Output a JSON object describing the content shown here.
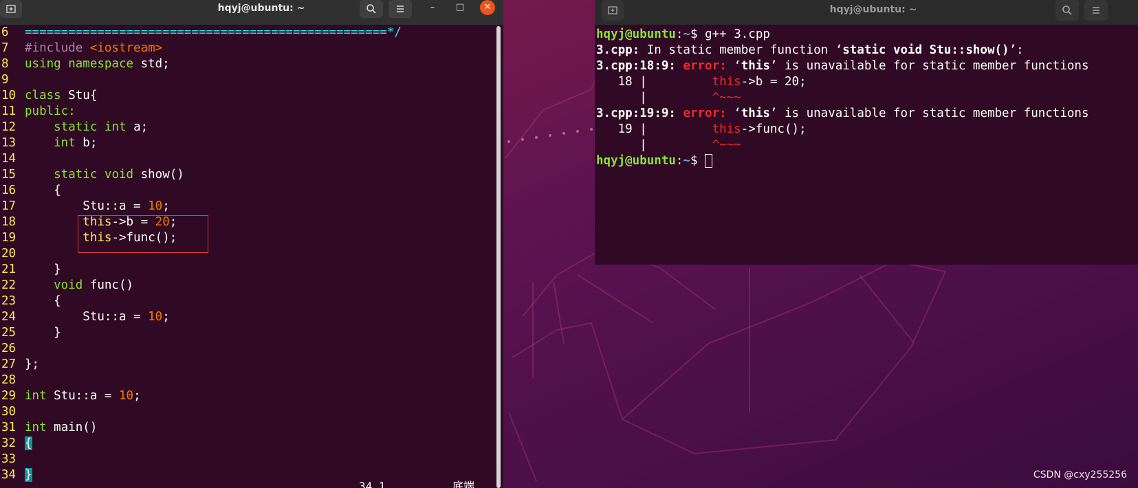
{
  "left_window": {
    "title": "hqyj@ubuntu: ~",
    "new_tab_icon": "new-tab-icon",
    "search_icon": "search-icon",
    "menu_icon": "hamburger-menu-icon",
    "minimize_glyph": "–",
    "maximize_glyph": "□",
    "close_glyph": "✕",
    "status_position": "34,1",
    "status_scroll": "底端"
  },
  "right_window": {
    "title": "hqyj@ubuntu: ~",
    "new_tab_icon": "new-tab-icon",
    "search_icon": "search-icon",
    "menu_icon": "hamburger-menu-icon"
  },
  "editor_lines": [
    {
      "n": "6",
      "parts": [
        {
          "t": "==================================================*/",
          "c": "c-cmt"
        }
      ]
    },
    {
      "n": "7",
      "parts": [
        {
          "t": "#include ",
          "c": "c-pp"
        },
        {
          "t": "<iostream>",
          "c": "c-num"
        }
      ]
    },
    {
      "n": "8",
      "parts": [
        {
          "t": "using ",
          "c": "c-kw"
        },
        {
          "t": "namespace ",
          "c": "c-kw"
        },
        {
          "t": "std;",
          "c": ""
        }
      ]
    },
    {
      "n": "9",
      "parts": []
    },
    {
      "n": "10",
      "parts": [
        {
          "t": "class ",
          "c": "c-kw"
        },
        {
          "t": "Stu{",
          "c": ""
        }
      ]
    },
    {
      "n": "11",
      "parts": [
        {
          "t": "public:",
          "c": "c-kw"
        }
      ]
    },
    {
      "n": "12",
      "parts": [
        {
          "t": "    static ",
          "c": "c-kw"
        },
        {
          "t": "int ",
          "c": "c-kw"
        },
        {
          "t": "a;",
          "c": ""
        }
      ]
    },
    {
      "n": "13",
      "parts": [
        {
          "t": "    int ",
          "c": "c-kw"
        },
        {
          "t": "b;",
          "c": ""
        }
      ]
    },
    {
      "n": "14",
      "parts": []
    },
    {
      "n": "15",
      "parts": [
        {
          "t": "    static ",
          "c": "c-kw"
        },
        {
          "t": "void ",
          "c": "c-kw"
        },
        {
          "t": "show()",
          "c": ""
        }
      ]
    },
    {
      "n": "16",
      "parts": [
        {
          "t": "    {",
          "c": ""
        }
      ]
    },
    {
      "n": "17",
      "parts": [
        {
          "t": "        Stu::a = ",
          "c": ""
        },
        {
          "t": "10",
          "c": "c-num"
        },
        {
          "t": ";",
          "c": ""
        }
      ]
    },
    {
      "n": "18",
      "parts": [
        {
          "t": "        ",
          "c": ""
        },
        {
          "t": "this",
          "c": "c-this"
        },
        {
          "t": "->b = ",
          "c": ""
        },
        {
          "t": "20",
          "c": "c-num"
        },
        {
          "t": ";",
          "c": ""
        }
      ]
    },
    {
      "n": "19",
      "parts": [
        {
          "t": "        ",
          "c": ""
        },
        {
          "t": "this",
          "c": "c-this"
        },
        {
          "t": "->func();",
          "c": ""
        }
      ]
    },
    {
      "n": "20",
      "parts": []
    },
    {
      "n": "21",
      "parts": [
        {
          "t": "    }",
          "c": ""
        }
      ]
    },
    {
      "n": "22",
      "parts": [
        {
          "t": "    void ",
          "c": "c-kw"
        },
        {
          "t": "func()",
          "c": ""
        }
      ]
    },
    {
      "n": "23",
      "parts": [
        {
          "t": "    {",
          "c": ""
        }
      ]
    },
    {
      "n": "24",
      "parts": [
        {
          "t": "        Stu::a = ",
          "c": ""
        },
        {
          "t": "10",
          "c": "c-num"
        },
        {
          "t": ";",
          "c": ""
        }
      ]
    },
    {
      "n": "25",
      "parts": [
        {
          "t": "    }",
          "c": ""
        }
      ]
    },
    {
      "n": "26",
      "parts": []
    },
    {
      "n": "27",
      "parts": [
        {
          "t": "};",
          "c": ""
        }
      ]
    },
    {
      "n": "28",
      "parts": []
    },
    {
      "n": "29",
      "parts": [
        {
          "t": "int ",
          "c": "c-kw"
        },
        {
          "t": "Stu::a = ",
          "c": ""
        },
        {
          "t": "10",
          "c": "c-num"
        },
        {
          "t": ";",
          "c": ""
        }
      ]
    },
    {
      "n": "30",
      "parts": []
    },
    {
      "n": "31",
      "parts": [
        {
          "t": "int ",
          "c": "c-kw"
        },
        {
          "t": "main()",
          "c": ""
        }
      ]
    },
    {
      "n": "32",
      "parts": [
        {
          "t": "{",
          "c": "cursor-block"
        }
      ]
    },
    {
      "n": "33",
      "parts": []
    },
    {
      "n": "34",
      "parts": [
        {
          "t": "}",
          "c": "cursor-block"
        }
      ]
    }
  ],
  "terminal_lines": [
    {
      "parts": [
        {
          "t": "hqyj@ubuntu",
          "c": "t-green"
        },
        {
          "t": ":",
          "c": ""
        },
        {
          "t": "~",
          "c": "t-blue"
        },
        {
          "t": "$ g++ 3.cpp",
          "c": ""
        }
      ]
    },
    {
      "parts": [
        {
          "t": "3.cpp:",
          "c": "t-bold"
        },
        {
          "t": " In static member function ‘",
          "c": ""
        },
        {
          "t": "static void Stu::show()",
          "c": "t-bold"
        },
        {
          "t": "’:",
          "c": ""
        }
      ]
    },
    {
      "parts": [
        {
          "t": "3.cpp:18:9: ",
          "c": "t-bold"
        },
        {
          "t": "error: ",
          "c": "t-red"
        },
        {
          "t": "‘",
          "c": ""
        },
        {
          "t": "this",
          "c": "t-bold"
        },
        {
          "t": "’ is unavailable for static member functions",
          "c": ""
        }
      ]
    },
    {
      "parts": [
        {
          "t": "   18 |         ",
          "c": ""
        },
        {
          "t": "this",
          "c": "t-redn"
        },
        {
          "t": "->b = 20;",
          "c": ""
        }
      ]
    },
    {
      "parts": [
        {
          "t": "      |         ",
          "c": ""
        },
        {
          "t": "^~~~",
          "c": "t-redn"
        }
      ]
    },
    {
      "parts": [
        {
          "t": "3.cpp:19:9: ",
          "c": "t-bold"
        },
        {
          "t": "error: ",
          "c": "t-red"
        },
        {
          "t": "‘",
          "c": ""
        },
        {
          "t": "this",
          "c": "t-bold"
        },
        {
          "t": "’ is unavailable for static member functions",
          "c": ""
        }
      ]
    },
    {
      "parts": [
        {
          "t": "   19 |         ",
          "c": ""
        },
        {
          "t": "this",
          "c": "t-redn"
        },
        {
          "t": "->func();",
          "c": ""
        }
      ]
    },
    {
      "parts": [
        {
          "t": "      |         ",
          "c": ""
        },
        {
          "t": "^~~~",
          "c": "t-redn"
        }
      ]
    },
    {
      "parts": [
        {
          "t": "hqyj@ubuntu",
          "c": "t-green"
        },
        {
          "t": ":",
          "c": ""
        },
        {
          "t": "~",
          "c": "t-blue"
        },
        {
          "t": "$ ",
          "c": ""
        },
        {
          "t": "",
          "c": "t-cursor"
        }
      ]
    }
  ],
  "watermark": "CSDN @cxy255256",
  "colors": {
    "terminal_bg": "#300a24",
    "desktop_bg": "#5c1347",
    "close_button": "#e95420",
    "highlight_box": "#e33a3a"
  }
}
